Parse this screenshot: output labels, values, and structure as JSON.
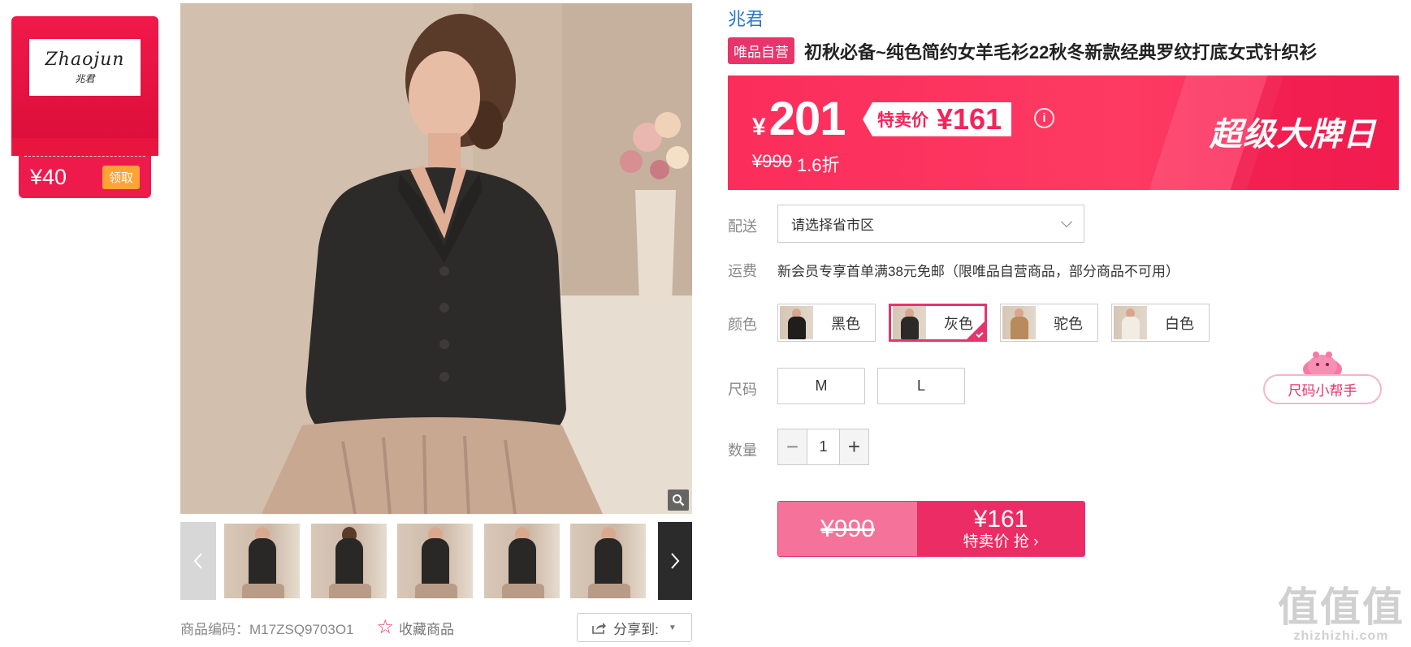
{
  "brand_card": {
    "logo_en": "Zhaojun",
    "logo_cn": "兆君",
    "coupon_amount": "¥40",
    "claim_label": "领取"
  },
  "gallery": {
    "thumbnails": [
      "thumb-1",
      "thumb-2",
      "thumb-3",
      "thumb-4",
      "thumb-5"
    ]
  },
  "meta": {
    "product_code": "商品编码：M17ZSQ9703O1",
    "favorite_label": "收藏商品",
    "share_label": "分享到:"
  },
  "product": {
    "brand": "兆君",
    "badge": "唯品自营",
    "title": "初秋必备~纯色简约女羊毛衫22秋冬新款经典罗纹打底女式针织衫"
  },
  "price": {
    "yen_symbol": "¥",
    "current": "201",
    "sale_label": "特卖价",
    "sale_price": "¥161",
    "original": "¥990",
    "discount": "1.6折",
    "promo_title": "超级大牌日",
    "info_symbol": "i"
  },
  "options": {
    "delivery_label": "配送",
    "delivery_placeholder": "请选择省市区",
    "shipping_label": "运费",
    "shipping_text": "新会员专享首单满38元免邮（限唯品自营商品，部分商品不可用）",
    "color_label": "颜色",
    "colors": [
      {
        "name": "黑色",
        "swatch": "#1f1e1d"
      },
      {
        "name": "灰色",
        "swatch": "#2b2a29"
      },
      {
        "name": "驼色",
        "swatch": "#b98a5c"
      },
      {
        "name": "白色",
        "swatch": "#f1ece4"
      }
    ],
    "selected_color": "灰色",
    "size_label": "尺码",
    "sizes": [
      "M",
      "L"
    ],
    "size_helper": "尺码小帮手",
    "qty_label": "数量",
    "qty_minus": "−",
    "qty_value": "1",
    "qty_plus": "+"
  },
  "buy": {
    "original": "¥990",
    "price": "¥161",
    "action": "特卖价 抢 ›"
  },
  "watermark": {
    "big": "值值值",
    "small": "zhizhizhi.com"
  },
  "colors": {
    "accent": "#e8336b",
    "banner": "#fb2d5b",
    "link": "#2a73c8"
  }
}
